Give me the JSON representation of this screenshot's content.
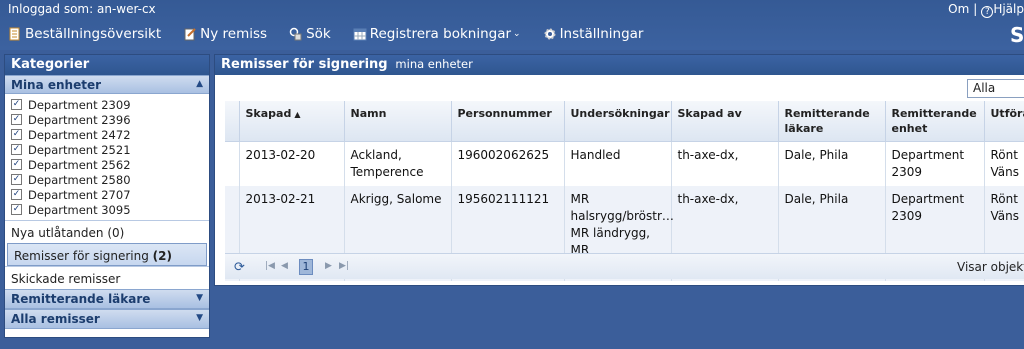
{
  "header": {
    "logged_in": "Inloggad som: an-wer-cx",
    "om": "Om",
    "help": "Hjälp",
    "nav": [
      {
        "label": "Beställningsöversikt",
        "icon": "order-overview-icon"
      },
      {
        "label": "Ny remiss",
        "icon": "new-referral-icon"
      },
      {
        "label": "Sök",
        "icon": "search-icon"
      },
      {
        "label": "Registrera bokningar",
        "icon": "calendar-icon"
      },
      {
        "label": "Inställningar",
        "icon": "gear-icon"
      }
    ],
    "logo": "S"
  },
  "sidebar": {
    "title": "Kategorier",
    "mina_enheter": "Mina enheter",
    "units": [
      {
        "label": "Department 2309",
        "checked": true
      },
      {
        "label": "Department 2396",
        "checked": true
      },
      {
        "label": "Department 2472",
        "checked": true
      },
      {
        "label": "Department 2521",
        "checked": true
      },
      {
        "label": "Department 2562",
        "checked": true
      },
      {
        "label": "Department 2580",
        "checked": true
      },
      {
        "label": "Department 2707",
        "checked": true
      },
      {
        "label": "Department 3095",
        "checked": true
      }
    ],
    "nya_utlatanden": "Nya utlåtanden (0)",
    "remisser_signering": "Remisser för signering",
    "remisser_signering_count": "(2)",
    "skickade": "Skickade remisser",
    "remitterande_lakare": "Remitterande läkare",
    "alla_remisser": "Alla remisser"
  },
  "main": {
    "title": "Remisser för signering",
    "subtitle": "mina enheter",
    "filter_value": "Alla",
    "columns": [
      "Skapad",
      "Namn",
      "Personnummer",
      "Undersökningar",
      "Skapad av",
      "Remitterande läkare",
      "Remitterande enhet",
      "Utföra"
    ],
    "rows": [
      [
        "2013-02-20",
        "Ackland, Temperence",
        "196002062625",
        "Handled",
        "th-axe-dx,",
        "Dale, Phila",
        "Department 2309",
        "Rönt Väns"
      ],
      [
        "2013-02-21",
        "Akrigg, Salome",
        "195602111121",
        "MR halsrygg/bröstr… MR ländrygg, MR bäcken/höftleder",
        "th-axe-dx,",
        "Dale, Phila",
        "Department 2309",
        "Rönt Väns"
      ]
    ],
    "pager": {
      "page": "1",
      "info": "Visar objekt"
    }
  },
  "colors": {
    "background": "#3b5e9a",
    "header": "#2f568f",
    "accordion": "#a9c0e2"
  }
}
